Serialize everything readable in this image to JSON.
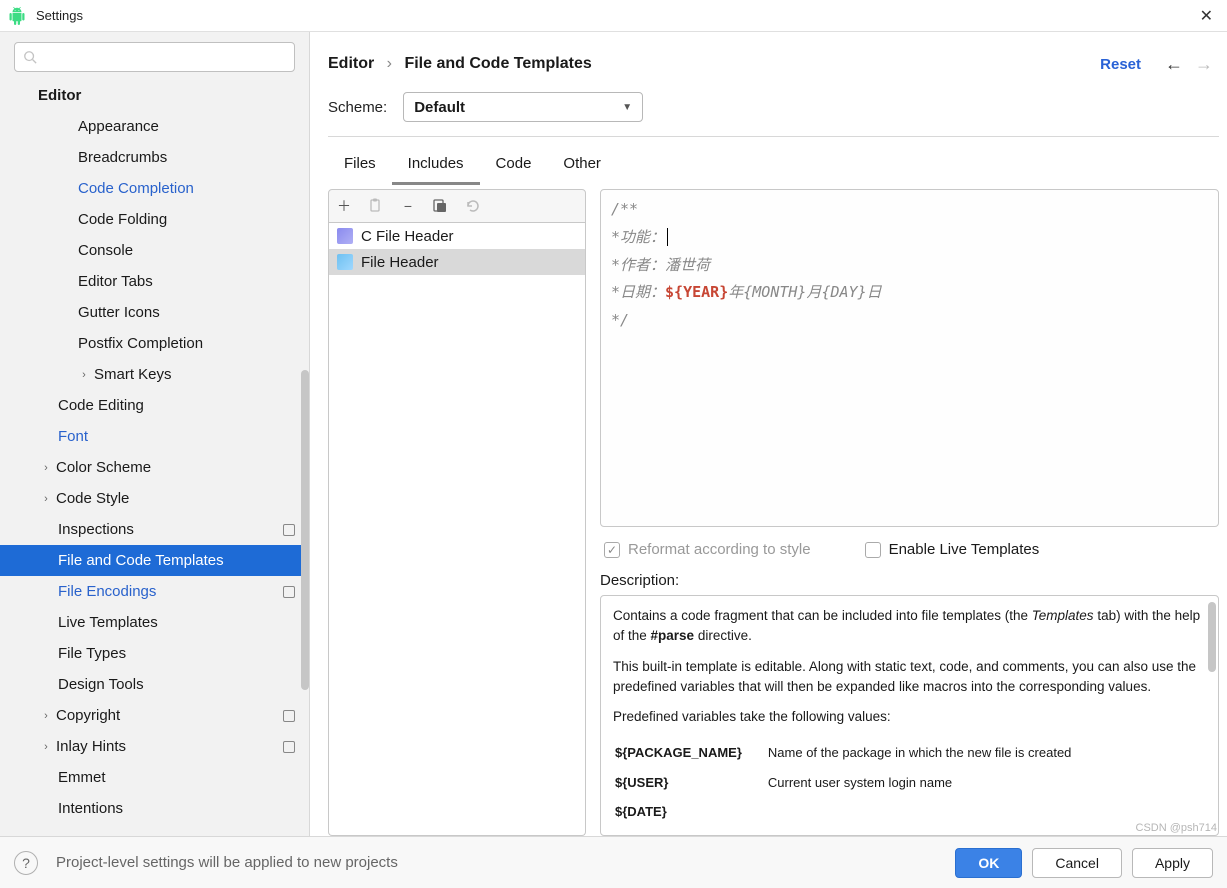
{
  "window": {
    "title": "Settings"
  },
  "sidebar": {
    "search_placeholder": "",
    "items": [
      {
        "label": "Editor",
        "level": "header"
      },
      {
        "label": "Appearance",
        "level": "lvl2"
      },
      {
        "label": "Breadcrumbs",
        "level": "lvl2"
      },
      {
        "label": "Code Completion",
        "level": "lvl2",
        "link": true
      },
      {
        "label": "Code Folding",
        "level": "lvl2"
      },
      {
        "label": "Console",
        "level": "lvl2"
      },
      {
        "label": "Editor Tabs",
        "level": "lvl2"
      },
      {
        "label": "Gutter Icons",
        "level": "lvl2"
      },
      {
        "label": "Postfix Completion",
        "level": "lvl2"
      },
      {
        "label": "Smart Keys",
        "level": "lvl2",
        "chevron": true
      },
      {
        "label": "Code Editing",
        "level": "lvl1"
      },
      {
        "label": "Font",
        "level": "lvl1",
        "link": true
      },
      {
        "label": "Color Scheme",
        "level": "lvl1c",
        "chevron": true
      },
      {
        "label": "Code Style",
        "level": "lvl1c",
        "chevron": true
      },
      {
        "label": "Inspections",
        "level": "lvl1",
        "badge": true
      },
      {
        "label": "File and Code Templates",
        "level": "lvl1",
        "selected": true
      },
      {
        "label": "File Encodings",
        "level": "lvl1",
        "link": true,
        "badge": true
      },
      {
        "label": "Live Templates",
        "level": "lvl1"
      },
      {
        "label": "File Types",
        "level": "lvl1"
      },
      {
        "label": "Design Tools",
        "level": "lvl1"
      },
      {
        "label": "Copyright",
        "level": "lvl1c",
        "chevron": true,
        "badge": true
      },
      {
        "label": "Inlay Hints",
        "level": "lvl1c",
        "chevron": true,
        "badge": true
      },
      {
        "label": "Emmet",
        "level": "lvl1"
      },
      {
        "label": "Intentions",
        "level": "lvl1"
      }
    ]
  },
  "breadcrumb": {
    "root": "Editor",
    "leaf": "File and Code Templates"
  },
  "reset_label": "Reset",
  "scheme": {
    "label": "Scheme:",
    "value": "Default"
  },
  "tabs": [
    {
      "label": "Files"
    },
    {
      "label": "Includes",
      "active": true
    },
    {
      "label": "Code"
    },
    {
      "label": "Other"
    }
  ],
  "template_list": [
    {
      "label": "C File Header",
      "icon": "cpp"
    },
    {
      "label": "File Header",
      "icon": "j",
      "selected": true
    }
  ],
  "editor": {
    "line1": "/**",
    "line2_prefix": "*功能：",
    "line3": "*作者：潘世荷",
    "line4_prefix": "*日期：",
    "line4_var": "${YEAR}",
    "line4_mid": "年{MONTH}月{DAY}日",
    "line5": "*/"
  },
  "checks": {
    "reformat": "Reformat according to style",
    "live": "Enable Live Templates"
  },
  "description": {
    "label": "Description:",
    "p1a": "Contains a code fragment that can be included into file templates (the ",
    "p1b": "Templates",
    "p1c": " tab) with the help of the ",
    "p1d": "#parse",
    "p1e": " directive.",
    "p2": "This built-in template is editable. Along with static text, code, and comments, you can also use the predefined variables that will then be expanded like macros into the corresponding values.",
    "p3": "Predefined variables take the following values:",
    "vars": [
      {
        "name": "${PACKAGE_NAME}",
        "desc": "Name of the package in which the new file is created"
      },
      {
        "name": "${USER}",
        "desc": "Current user system login name"
      },
      {
        "name": "${DATE}",
        "desc": ""
      }
    ]
  },
  "footer": {
    "msg": "Project-level settings will be applied to new projects",
    "ok": "OK",
    "cancel": "Cancel",
    "apply": "Apply"
  },
  "watermark": "CSDN @psh714"
}
